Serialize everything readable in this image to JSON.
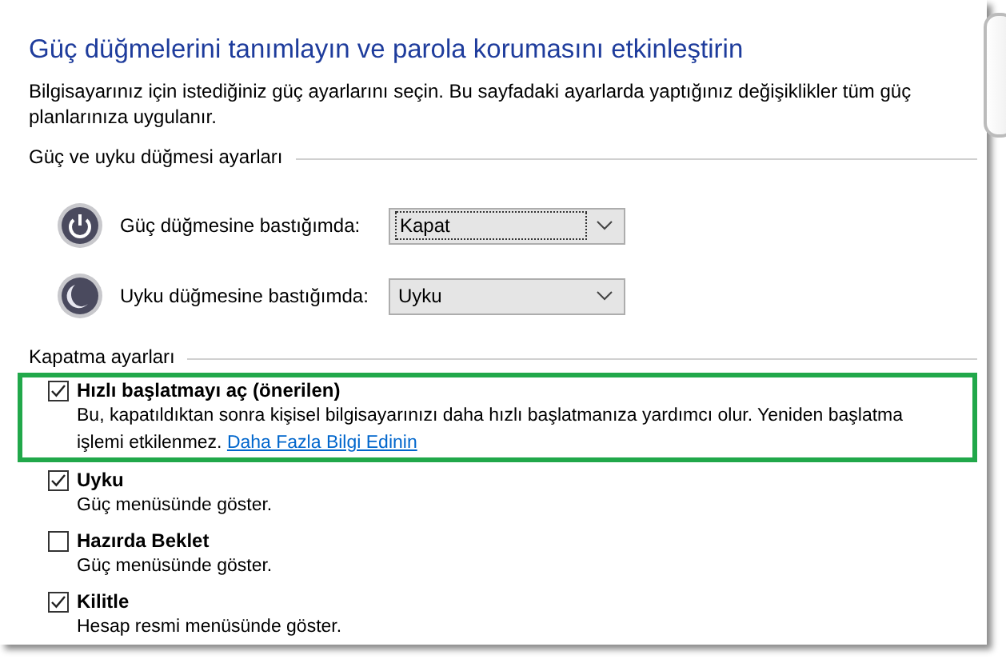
{
  "title": "Güç düğmelerini tanımlayın ve parola korumasını etkinleştirin",
  "intro": "Bilgisayarınız için istediğiniz güç ayarlarını seçin. Bu sayfadaki ayarlarda yaptığınız değişiklikler tüm güç planlarınıza uygulanır.",
  "button_section": {
    "heading": "Güç ve uyku düğmesi ayarları",
    "rows": [
      {
        "kind": "power",
        "label": "Güç düğmesine bastığımda:",
        "value": "Kapat",
        "focused": true
      },
      {
        "kind": "sleep",
        "label": "Uyku düğmesine bastığımda:",
        "value": "Uyku",
        "focused": false
      }
    ]
  },
  "shutdown_section": {
    "heading": "Kapatma ayarları",
    "options": [
      {
        "label": "Hızlı başlatmayı aç (önerilen)",
        "checked": true,
        "highlighted": true,
        "description": "Bu, kapatıldıktan sonra kişisel bilgisayarınızı daha hızlı başlatmanıza yardımcı olur. Yeniden başlatma işlemi etkilenmez.",
        "link": "Daha Fazla Bilgi Edinin"
      },
      {
        "label": "Uyku",
        "checked": true,
        "highlighted": false,
        "description": "Güç menüsünde göster."
      },
      {
        "label": "Hazırda Beklet",
        "checked": false,
        "highlighted": false,
        "description": "Güç menüsünde göster."
      },
      {
        "label": "Kilitle",
        "checked": true,
        "highlighted": false,
        "description": "Hesap resmi menüsünde göster."
      }
    ]
  }
}
